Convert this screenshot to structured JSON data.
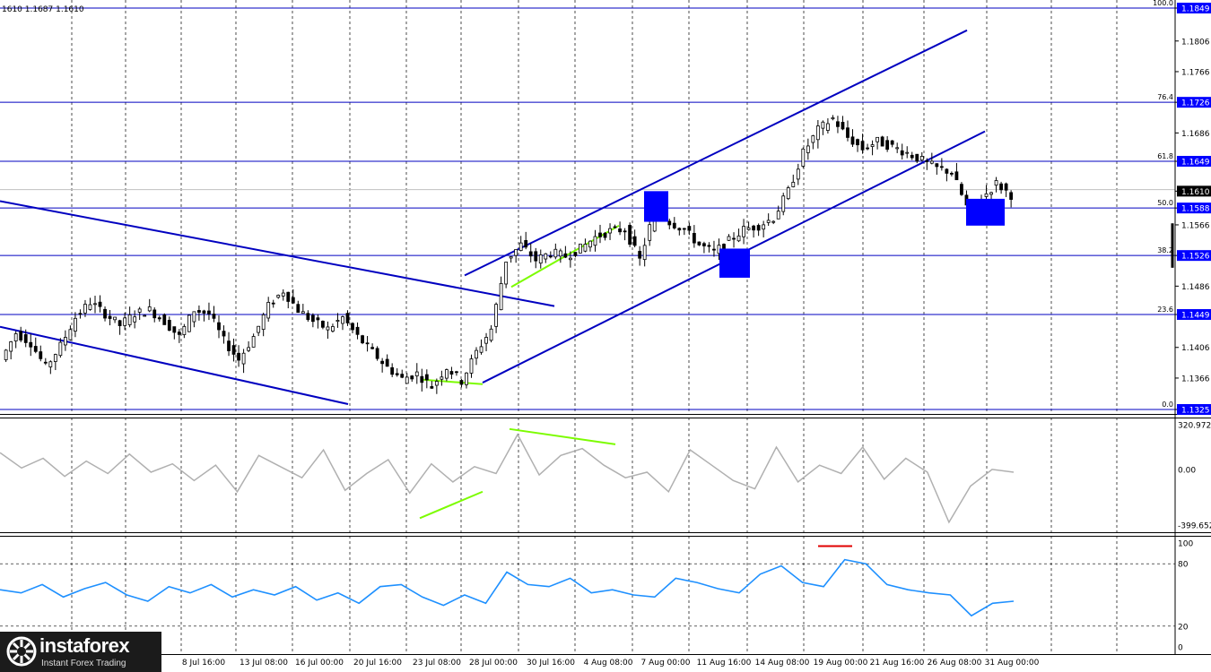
{
  "header": {
    "ohlc_text": "1610 1.1687 1.1610"
  },
  "chart_data": [
    {
      "type": "candlestick",
      "symbol_pair": "EUR/USD",
      "y_range": [
        1.1325,
        1.1849
      ],
      "y_ticks": [
        "1.1849",
        "1.1806",
        "1.1766",
        "1.1726",
        "1.1686",
        "1.1649",
        "1.1610",
        "1.1588",
        "1.1566",
        "1.1526",
        "1.1486",
        "1.1449",
        "1.1406",
        "1.1366",
        "1.1325"
      ],
      "highlighted_prices": [
        "1.1849",
        "1.1726",
        "1.1649",
        "1.1610",
        "1.1588",
        "1.1526",
        "1.1449",
        "1.1325"
      ],
      "current_price": "1.1610",
      "fib_levels": [
        {
          "label": "100.0",
          "price": 1.1849
        },
        {
          "label": "76.4",
          "price": 1.1726
        },
        {
          "label": "61.8",
          "price": 1.1649
        },
        {
          "label": "50.0",
          "price": 1.1588
        },
        {
          "label": "38.2",
          "price": 1.1526
        },
        {
          "label": "23.6",
          "price": 1.1449
        },
        {
          "label": "0.0",
          "price": 1.1325
        }
      ],
      "close_series": [
        1.139,
        1.1425,
        1.1412,
        1.138,
        1.1408,
        1.1445,
        1.1465,
        1.145,
        1.1435,
        1.145,
        1.1455,
        1.144,
        1.142,
        1.1455,
        1.145,
        1.1415,
        1.139,
        1.142,
        1.146,
        1.148,
        1.1455,
        1.144,
        1.143,
        1.1445,
        1.142,
        1.14,
        1.138,
        1.1365,
        1.1372,
        1.1355,
        1.138,
        1.1362,
        1.14,
        1.143,
        1.152,
        1.154,
        1.152,
        1.153,
        1.1525,
        1.1535,
        1.155,
        1.1558,
        1.156,
        1.152,
        1.1585,
        1.157,
        1.156,
        1.154,
        1.153,
        1.1545,
        1.156,
        1.1565,
        1.1575,
        1.161,
        1.166,
        1.169,
        1.1705,
        1.168,
        1.1665,
        1.1675,
        1.1668,
        1.166,
        1.165,
        1.164,
        1.1635,
        1.159,
        1.16,
        1.162,
        1.1605
      ]
    },
    {
      "type": "line",
      "indicator": "CCI",
      "y_ticks": [
        "320.9724",
        "0.00",
        "-399.6524"
      ],
      "values": [
        120,
        10,
        80,
        -50,
        60,
        -30,
        110,
        -20,
        40,
        -80,
        30,
        -160,
        100,
        20,
        -60,
        140,
        -150,
        -30,
        70,
        -170,
        40,
        -90,
        20,
        -30,
        250,
        -40,
        100,
        150,
        30,
        -60,
        -20,
        -160,
        140,
        30,
        -80,
        -140,
        160,
        -90,
        30,
        -30,
        160,
        -70,
        80,
        -20,
        -380,
        -120,
        0,
        -20
      ]
    },
    {
      "type": "line",
      "indicator": "Stochastic",
      "y_ticks": [
        "100",
        "80",
        "20",
        "0"
      ],
      "levels": [
        80,
        20
      ],
      "values": [
        55,
        52,
        60,
        48,
        56,
        62,
        50,
        44,
        58,
        52,
        60,
        48,
        55,
        50,
        58,
        45,
        52,
        42,
        58,
        60,
        48,
        40,
        50,
        42,
        72,
        60,
        58,
        66,
        52,
        55,
        50,
        48,
        66,
        62,
        56,
        52,
        70,
        78,
        62,
        58,
        84,
        80,
        60,
        55,
        52,
        50,
        30,
        42,
        44
      ]
    }
  ],
  "x_axis_labels": [
    "8 Jul 16:00",
    "13 Jul 08:00",
    "16 Jul 00:00",
    "20 Jul 16:00",
    "23 Jul 08:00",
    "28 Jul 00:00",
    "30 Jul 16:00",
    "4 Aug 08:00",
    "7 Aug 00:00",
    "11 Aug 16:00",
    "14 Aug 08:00",
    "19 Aug 00:00",
    "21 Aug 16:00",
    "26 Aug 08:00",
    "31 Aug 00:00"
  ],
  "colors": {
    "trend_lines": "#0000c0",
    "divergence": "#7cfc00",
    "zone_box": "#0000ff",
    "cci_line": "#b0b0b0",
    "stoch_line": "#1e90ff",
    "overbought_mark": "#e00000"
  },
  "watermark": {
    "brand": "instaforex",
    "tagline": "Instant Forex Trading"
  }
}
